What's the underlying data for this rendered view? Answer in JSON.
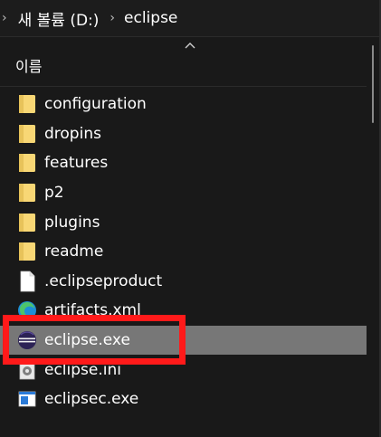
{
  "breadcrumb": {
    "items": [
      "새 볼륨 (D:)",
      "eclipse"
    ]
  },
  "columns": {
    "name_header": "이름"
  },
  "files": [
    {
      "name": "configuration",
      "type": "folder"
    },
    {
      "name": "dropins",
      "type": "folder"
    },
    {
      "name": "features",
      "type": "folder"
    },
    {
      "name": "p2",
      "type": "folder"
    },
    {
      "name": "plugins",
      "type": "folder"
    },
    {
      "name": "readme",
      "type": "folder"
    },
    {
      "name": ".eclipseproduct",
      "type": "file"
    },
    {
      "name": "artifacts.xml",
      "type": "xml"
    },
    {
      "name": "eclipse.exe",
      "type": "eclipse-exe",
      "selected": true
    },
    {
      "name": "eclipse.ini",
      "type": "ini"
    },
    {
      "name": "eclipsec.exe",
      "type": "exe"
    }
  ],
  "colors": {
    "background": "#191919",
    "selected_row": "#777777",
    "highlight_border": "#ff1a1a",
    "folder_yellow": "#f8d775"
  }
}
